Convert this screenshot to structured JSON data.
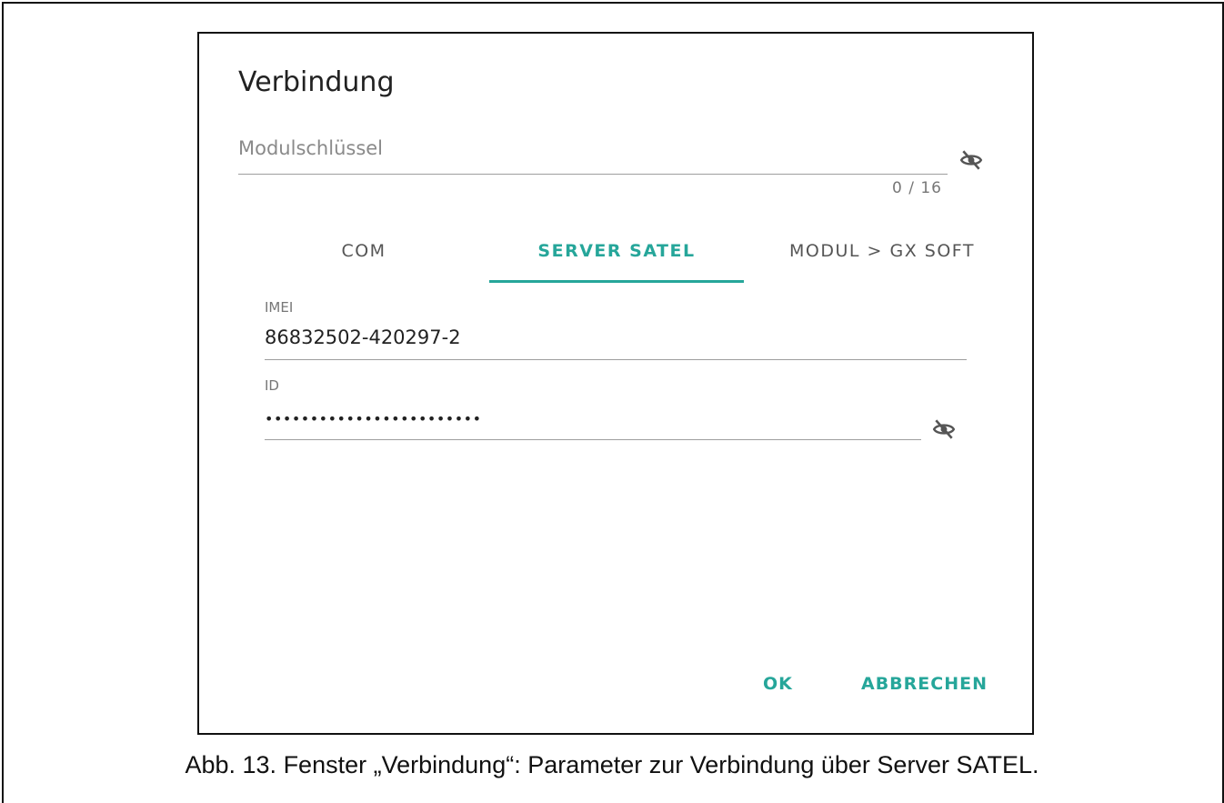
{
  "dialog": {
    "title": "Verbindung",
    "module_key": {
      "placeholder": "Modulschlüssel",
      "counter": "0 / 16",
      "icon": "eye-off-icon"
    },
    "tabs": [
      {
        "label": "COM",
        "active": false
      },
      {
        "label": "SERVER SATEL",
        "active": true
      },
      {
        "label": "MODUL > GX SOFT",
        "active": false
      }
    ],
    "imei": {
      "label": "IMEI",
      "value": "86832502-420297-2"
    },
    "id": {
      "label": "ID",
      "value": "••••••••••••••••••••••••",
      "icon": "eye-off-icon"
    },
    "buttons": {
      "ok": "OK",
      "cancel": "ABBRECHEN"
    }
  },
  "caption": "Abb. 13. Fenster „Verbindung“: Parameter zur Verbindung über Server SATEL.",
  "colors": {
    "accent": "#26a69a",
    "text": "#222222",
    "muted": "#8a8a8a",
    "line": "#9e9e9e"
  }
}
